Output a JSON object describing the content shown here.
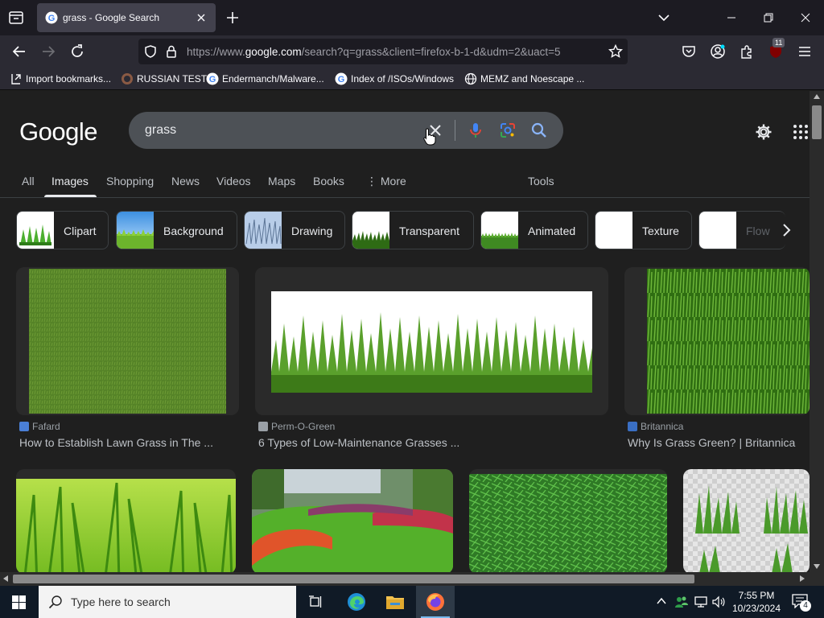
{
  "browser": {
    "tab_title": "grass - Google Search",
    "url_prefix": "https://www.",
    "url_domain": "google.com",
    "url_suffix": "/search?q=grass&client=firefox-b-1-d&udm=2&uact=5",
    "extensions_badge": "11",
    "bookmarks": [
      {
        "label": "Import bookmarks...",
        "icon": "import-icon"
      },
      {
        "label": "RUSSIAN TEST",
        "icon": "github-icon"
      },
      {
        "label": "Endermanch/Malware...",
        "icon": "google-icon"
      },
      {
        "label": "Index of /ISOs/Windows",
        "icon": "google-icon"
      },
      {
        "label": "MEMZ and Noescape ...",
        "icon": "globe-icon"
      }
    ]
  },
  "google": {
    "logo": "Google",
    "query": "grass",
    "tabs": [
      "All",
      "Images",
      "Shopping",
      "News",
      "Videos",
      "Maps",
      "Books",
      "More"
    ],
    "active_tab": "Images",
    "tools": "Tools",
    "chips": [
      "Clipart",
      "Background",
      "Drawing",
      "Transparent",
      "Animated",
      "Texture",
      "Flow"
    ],
    "results": [
      {
        "source": "Fafard",
        "title": "How to Establish Lawn Grass in The ..."
      },
      {
        "source": "Perm-O-Green",
        "title": "6 Types of Low-Maintenance Grasses ..."
      },
      {
        "source": "Britannica",
        "title": "Why Is Grass Green? | Britannica"
      }
    ]
  },
  "taskbar": {
    "search_placeholder": "Type here to search",
    "time": "7:55 PM",
    "date": "10/23/2024",
    "notifications": "4"
  },
  "colors": {
    "accent_blue": "#8ab4f8",
    "chrome_dark": "#1c1b22",
    "page_bg": "#1f1f1f",
    "grass_green": "#5aa02c"
  }
}
